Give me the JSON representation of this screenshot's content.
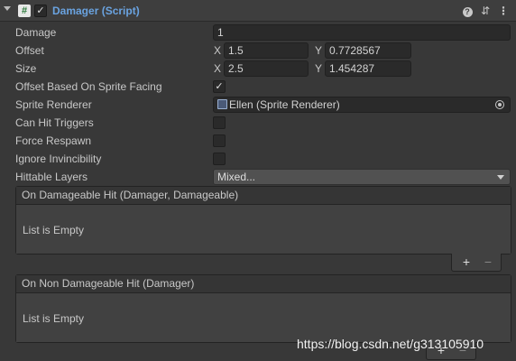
{
  "header": {
    "script_icon": "#",
    "enabled_check": "✓",
    "title": "Damager (Script)",
    "help_icon": "?",
    "presets_icon": "⇵",
    "more_icon": "⋮"
  },
  "fields": {
    "damage": {
      "label": "Damage",
      "value": "1"
    },
    "offset": {
      "label": "Offset",
      "x_label": "X",
      "x": "1.5",
      "y_label": "Y",
      "y": "0.7728567"
    },
    "size": {
      "label": "Size",
      "x_label": "X",
      "x": "2.5",
      "y_label": "Y",
      "y": "1.454287"
    },
    "offset_based_on_sprite_facing": {
      "label": "Offset Based On Sprite Facing",
      "checked": "✓"
    },
    "sprite_renderer": {
      "label": "Sprite Renderer",
      "value": "Ellen (Sprite Renderer)"
    },
    "can_hit_triggers": {
      "label": "Can Hit Triggers"
    },
    "force_respawn": {
      "label": "Force Respawn"
    },
    "ignore_invincibility": {
      "label": "Ignore Invincibility"
    },
    "hittable_layers": {
      "label": "Hittable Layers",
      "value": "Mixed..."
    }
  },
  "events": [
    {
      "title": "On Damageable Hit (Damager, Damageable)",
      "empty_text": "List is Empty",
      "add": "+",
      "remove": "−"
    },
    {
      "title": "On Non Damageable Hit (Damager)",
      "empty_text": "List is Empty",
      "add": "+",
      "remove": "−"
    }
  ],
  "watermark": "https://blog.csdn.net/g313105910",
  "colors": {
    "background": "#383838",
    "title": "#6aa3e0",
    "field": "#2a2a2a"
  }
}
